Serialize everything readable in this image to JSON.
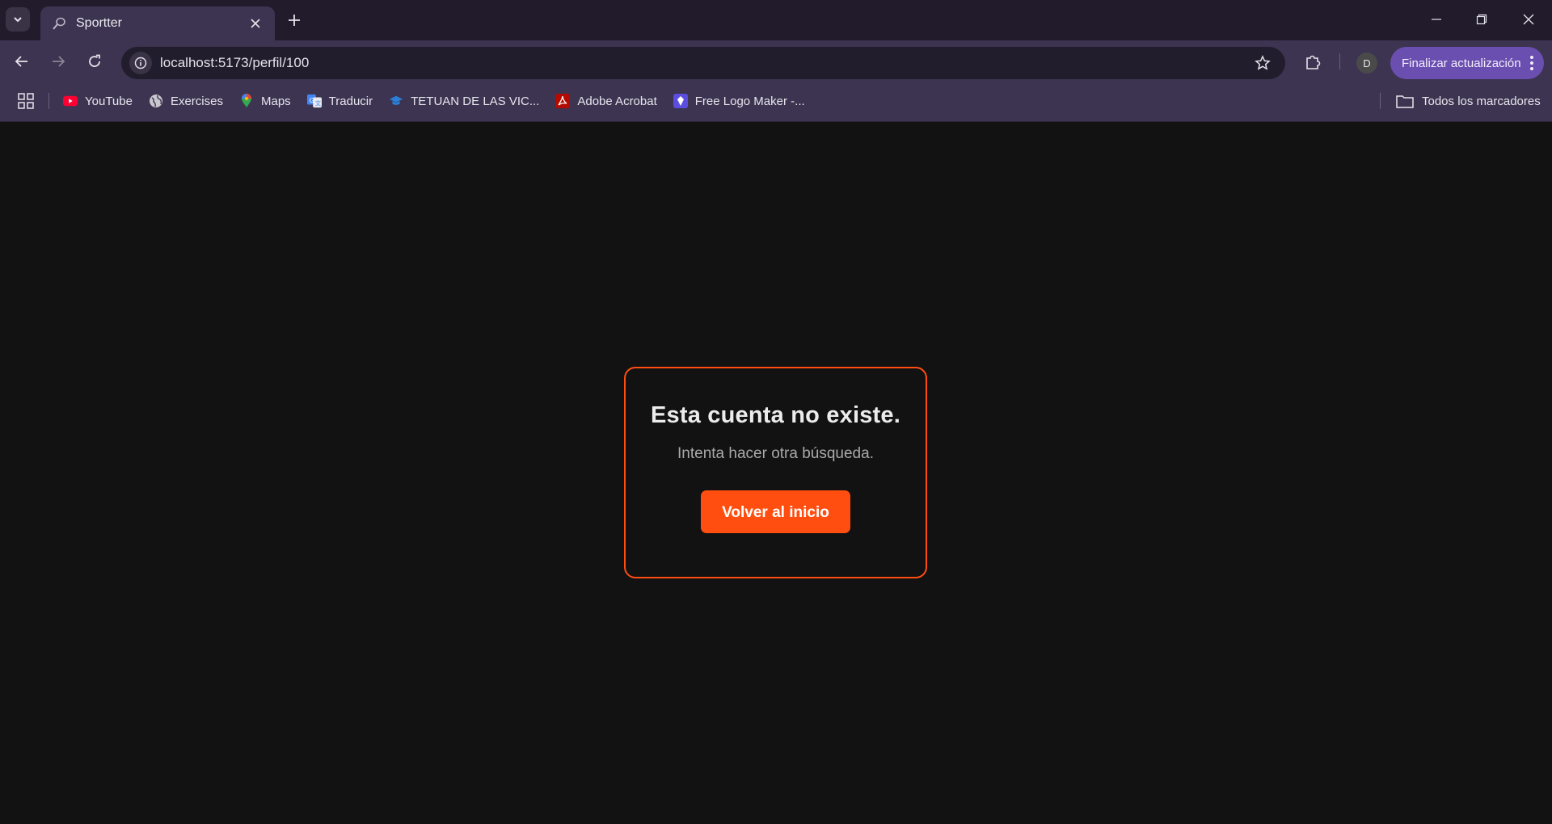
{
  "browser": {
    "tab": {
      "title": "Sportter"
    },
    "url": "localhost:5173/perfil/100",
    "avatar_letter": "D",
    "update_label": "Finalizar actualización",
    "bookmarks": [
      {
        "label": "YouTube",
        "icon": "youtube-icon"
      },
      {
        "label": "Exercises",
        "icon": "globe-icon"
      },
      {
        "label": "Maps",
        "icon": "maps-pin-icon"
      },
      {
        "label": "Traducir",
        "icon": "translate-icon"
      },
      {
        "label": "TETUAN DE LAS VIC...",
        "icon": "graduation-cap-icon"
      },
      {
        "label": "Adobe Acrobat",
        "icon": "acrobat-icon"
      },
      {
        "label": "Free Logo Maker -...",
        "icon": "logo-maker-icon"
      }
    ],
    "all_bookmarks_label": "Todos los marcadores"
  },
  "card": {
    "title": "Esta cuenta no existe.",
    "subtitle": "Intenta hacer otra búsqueda.",
    "button_label": "Volver al inicio"
  },
  "colors": {
    "accent": "#ff4e0f",
    "page_bg": "#121212",
    "chrome_bg": "#3c3450",
    "update_button": "#6b4fb0"
  }
}
